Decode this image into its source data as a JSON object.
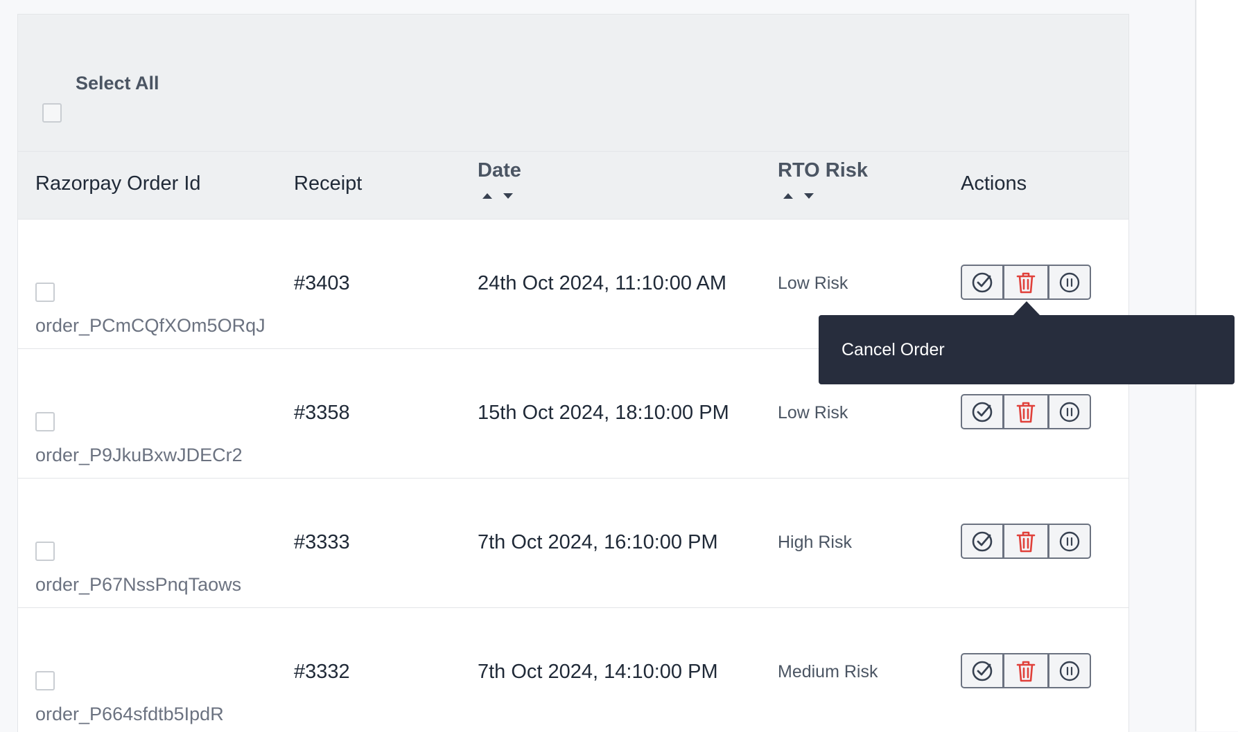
{
  "select_all": {
    "label": "Select All"
  },
  "columns": {
    "order_id": "Razorpay Order Id",
    "receipt": "Receipt",
    "date": "Date",
    "rto_risk": "RTO Risk",
    "actions": "Actions"
  },
  "rows": [
    {
      "order_id": "order_PCmCQfXOm5ORqJ",
      "receipt": "#3403",
      "date": "24th Oct 2024, 11:10:00 AM",
      "rto_risk": "Low Risk"
    },
    {
      "order_id": "order_P9JkuBxwJDECr2",
      "receipt": "#3358",
      "date": "15th Oct 2024, 18:10:00 PM",
      "rto_risk": "Low Risk"
    },
    {
      "order_id": "order_P67NssPnqTaows",
      "receipt": "#3333",
      "date": "7th Oct 2024, 16:10:00 PM",
      "rto_risk": "High Risk"
    },
    {
      "order_id": "order_P664sfdtb5IpdR",
      "receipt": "#3332",
      "date": "7th Oct 2024, 14:10:00 PM",
      "rto_risk": "Medium Risk"
    }
  ],
  "actions_icons": [
    "check-circle-icon",
    "trash-icon",
    "pause-circle-icon"
  ],
  "tooltip": {
    "text": "Cancel Order"
  },
  "colors": {
    "tooltip_bg": "#272d3d",
    "delete_red": "#e0403a",
    "header_bg": "#eef0f2"
  }
}
